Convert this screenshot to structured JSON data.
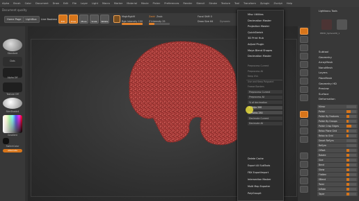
{
  "menubar": [
    "Alpha",
    "Brush",
    "Color",
    "Document",
    "Draw",
    "Edit",
    "File",
    "Layer",
    "Light",
    "Macro",
    "Marker",
    "Material",
    "Movie",
    "Picker",
    "Preferences",
    "Render",
    "Stencil",
    "Stroke",
    "Texture",
    "Tool",
    "Transform",
    "Zplugin",
    "Zscript",
    "Help"
  ],
  "document_title": "Document quality",
  "left_buttons": {
    "home": "Home Page",
    "lightbox": "LightBox",
    "live_boolean": "Live Boolean"
  },
  "toolbar": {
    "edit": "Edit",
    "draw": "Draw",
    "move": "Move",
    "scale": "Scale",
    "rotate": "Rotate",
    "mrgb": "Mrgb",
    "rgb": "Rgb",
    "m": "M",
    "rgb_intensity_label": "Rgb Intensity 100",
    "rgb_intensity": 1.0,
    "zadd": "Zadd",
    "zsub": "Zsub",
    "z_intensity_label": "Z Intensity 25",
    "z_intensity": 0.25,
    "focal_shift_label": "Focal Shift 0",
    "draw_size_label": "Draw Size 64",
    "dynamic_label": "Dynamic"
  },
  "left_panel": {
    "standard": "Standard",
    "dots": "Dots",
    "alpha_off": "Alpha Off",
    "texture_off": "Texture Off",
    "material": "SkinShade4",
    "gradient": "Gradient",
    "switch_color": "SwitchColor",
    "alternate": "Alternate",
    "primary_color": "#c0392b"
  },
  "dropdown": {
    "items": [
      {
        "label": "Misc Utilities"
      },
      {
        "label": "Decimation Master"
      },
      {
        "label": "Projection Master"
      },
      {
        "label": "QuickSketch"
      },
      {
        "label": "3D Print Hub"
      },
      {
        "label": "Adjust Plugin"
      },
      {
        "label": "Maya Blend Shapes"
      },
      {
        "label": "Decimation Master"
      }
    ],
    "sub_items": [
      {
        "label": "Preprocess Current",
        "dim": true
      },
      {
        "label": "Preprocess All",
        "dim": true
      },
      {
        "label": "Keep UVs",
        "dim": true
      },
      {
        "label": "Use and Keep Polypaint",
        "dim": true
      },
      {
        "label": "Freeze Borders",
        "dim": true
      }
    ],
    "boxes": [
      {
        "label": "Preprocess Current"
      },
      {
        "label": "Preprocess All"
      },
      {
        "label": "% of decimation"
      },
      {
        "label": "k Polys 200"
      },
      {
        "label": "k Points 250"
      },
      {
        "label": "Decimate Current"
      },
      {
        "label": "Decimate All"
      }
    ],
    "bottom_items": [
      {
        "label": "Delete Cache"
      },
      {
        "label": "Export All SubTools"
      },
      {
        "label": "FBX ExportImport"
      },
      {
        "label": "Intersection Masker"
      },
      {
        "label": "Multi Map Exporter"
      },
      {
        "label": "PolyGroupIt"
      }
    ]
  },
  "right_panel": {
    "header": "Lightbox ▸ Tools",
    "tool_name": "PM3D_Sphere3D_1",
    "sections": [
      "Subtool",
      "Geometry",
      "ArrayMesh",
      "NanoMesh",
      "Layers",
      "FiberMesh",
      "Geometry HD",
      "Preview",
      "Surface",
      "Deformation"
    ],
    "rows": [
      {
        "label": "Mirror",
        "value": 0
      },
      {
        "label": "Polish",
        "value": 0.4
      },
      {
        "label": "Polish By Features",
        "value": 0.3
      },
      {
        "label": "Polish By Groups",
        "value": 0.2
      },
      {
        "label": "Polish Crisp Edges",
        "value": 0.5
      },
      {
        "label": "Relax Plane Grid",
        "value": 0.2
      },
      {
        "label": "Relax to Grid",
        "value": 0.2
      },
      {
        "label": "Smart ReSym",
        "value": 0
      },
      {
        "label": "ReSym",
        "value": 0
      },
      {
        "label": "Offset",
        "value": 0.3
      },
      {
        "label": "Rotate",
        "value": 0.3
      },
      {
        "label": "Size",
        "value": 0.3
      },
      {
        "label": "Bend",
        "value": 0.3
      },
      {
        "label": "Skew",
        "value": 0.3
      },
      {
        "label": "Flatten",
        "value": 0.3
      },
      {
        "label": "SBend",
        "value": 0.3
      },
      {
        "label": "Twist",
        "value": 0.3
      },
      {
        "label": "Inflate",
        "value": 0.3
      },
      {
        "label": "Taper",
        "value": 0.3
      }
    ]
  },
  "colors": {
    "accent": "#d8751a",
    "mesh": "#b0413e"
  }
}
